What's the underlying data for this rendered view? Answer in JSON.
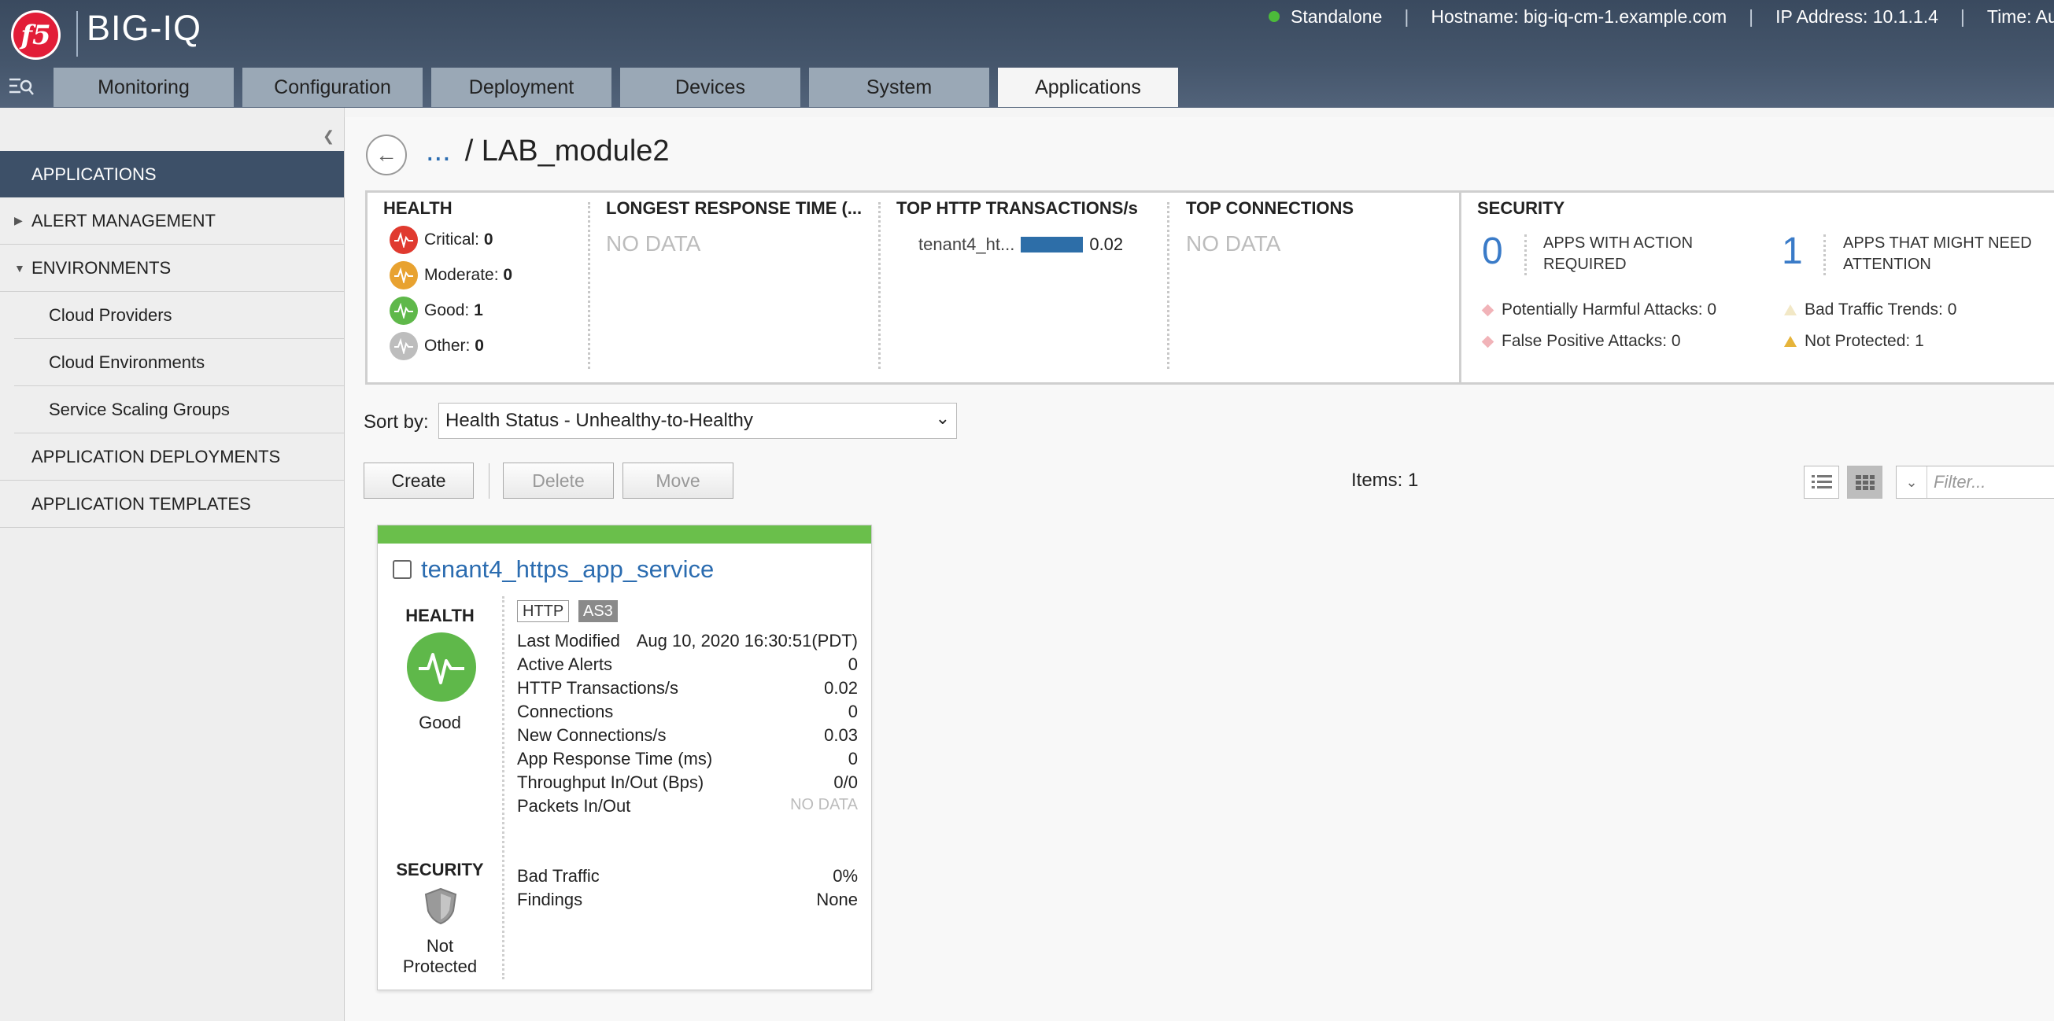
{
  "header": {
    "logo_text": "f5",
    "app_name": "BIG-IQ",
    "status": "Standalone",
    "hostname": "Hostname: big-iq-cm-1.example.com",
    "ip": "IP Address: 10.1.1.4",
    "time": "Time: Aug"
  },
  "tabs": [
    "Monitoring",
    "Configuration",
    "Deployment",
    "Devices",
    "System",
    "Applications"
  ],
  "active_tab": "Applications",
  "sidebar": {
    "items": [
      {
        "label": "APPLICATIONS"
      },
      {
        "label": "ALERT MANAGEMENT"
      },
      {
        "label": "ENVIRONMENTS"
      },
      {
        "label": "Cloud Providers"
      },
      {
        "label": "Cloud Environments"
      },
      {
        "label": "Service Scaling Groups"
      },
      {
        "label": "APPLICATION DEPLOYMENTS"
      },
      {
        "label": "APPLICATION TEMPLATES"
      }
    ]
  },
  "breadcrumb": {
    "ellipsis": "...",
    "current": "/ LAB_module2"
  },
  "dashboard": {
    "health": {
      "title": "HEALTH",
      "critical_label": "Critical:",
      "critical": "0",
      "moderate_label": "Moderate:",
      "moderate": "0",
      "good_label": "Good:",
      "good": "1",
      "other_label": "Other:",
      "other": "0"
    },
    "response": {
      "title": "LONGEST RESPONSE TIME (...",
      "value": "NO DATA"
    },
    "http": {
      "title": "TOP HTTP TRANSACTIONS/s",
      "app": "tenant4_ht...",
      "value": "0.02"
    },
    "connections": {
      "title": "TOP CONNECTIONS",
      "value": "NO DATA"
    },
    "security": {
      "title": "SECURITY",
      "action_count": "0",
      "action_label": "APPS WITH ACTION REQUIRED",
      "attention_count": "1",
      "attention_label": "APPS THAT MIGHT NEED ATTENTION",
      "harmful": "Potentially Harmful Attacks: 0",
      "false_positive": "False Positive Attacks: 0",
      "bad_trends": "Bad Traffic Trends: 0",
      "not_protected": "Not Protected: 1"
    }
  },
  "toolbar": {
    "sort_label": "Sort by:",
    "sort_value": "Health Status - Unhealthy-to-Healthy",
    "create": "Create",
    "delete": "Delete",
    "move": "Move",
    "items": "Items: 1",
    "filter_placeholder": "Filter..."
  },
  "card": {
    "title": "tenant4_https_app_service",
    "health_label": "HEALTH",
    "health_status": "Good",
    "badge_http": "HTTP",
    "badge_as3": "AS3",
    "metrics": [
      {
        "label": "Last Modified",
        "value": "Aug 10, 2020 16:30:51(PDT)"
      },
      {
        "label": "Active Alerts",
        "value": "0"
      },
      {
        "label": "HTTP Transactions/s",
        "value": "0.02"
      },
      {
        "label": "Connections",
        "value": "0"
      },
      {
        "label": "New Connections/s",
        "value": "0.03"
      },
      {
        "label": "App Response Time (ms)",
        "value": "0"
      },
      {
        "label": "Throughput In/Out (Bps)",
        "value": "0/0"
      },
      {
        "label": "Packets In/Out",
        "value": "NO DATA"
      }
    ],
    "security_label": "SECURITY",
    "security_status_1": "Not",
    "security_status_2": "Protected",
    "security_metrics": [
      {
        "label": "Bad Traffic",
        "value": "0%"
      },
      {
        "label": "Findings",
        "value": "None"
      }
    ]
  },
  "colors": {
    "critical": "#e03a2f",
    "moderate": "#e8a230",
    "good": "#5fb84a",
    "other": "#bdbdbd",
    "accent_blue": "#2b6cb0",
    "header": "#45566c"
  }
}
